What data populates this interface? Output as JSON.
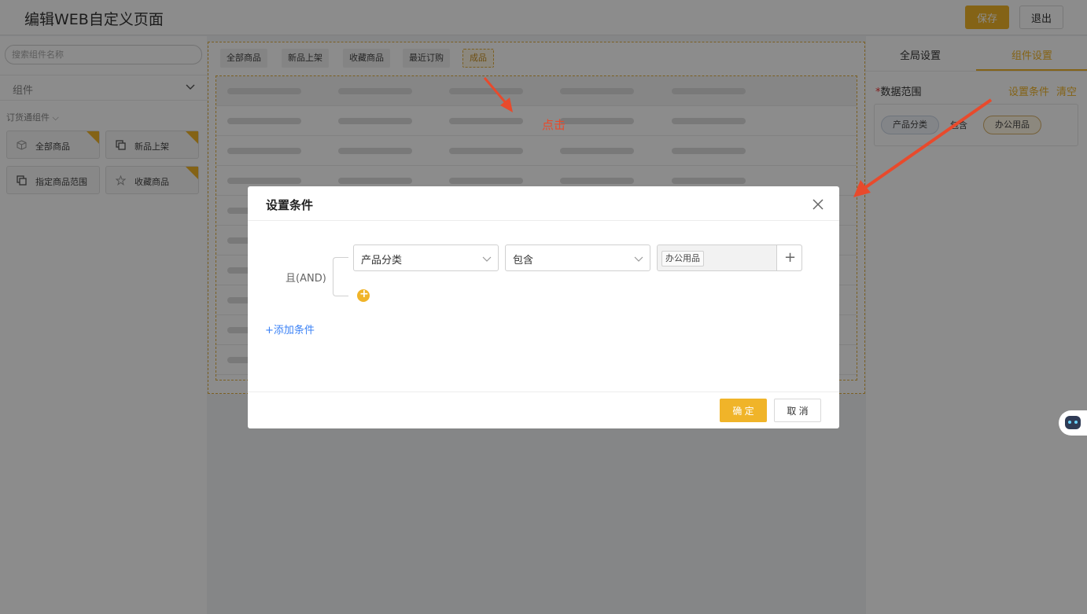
{
  "header": {
    "title": "编辑WEB自定义页面",
    "save_label": "保存",
    "exit_label": "退出"
  },
  "left_panel": {
    "search_placeholder": "搜索组件名称",
    "group_label": "组件",
    "sub_group_label": "订货通组件",
    "components": [
      {
        "label": "全部商品",
        "icon": "cube-icon"
      },
      {
        "label": "新品上架",
        "icon": "copy-icon"
      },
      {
        "label": "指定商品范围",
        "icon": "copy-icon"
      },
      {
        "label": "收藏商品",
        "icon": "star-icon"
      }
    ]
  },
  "canvas": {
    "tabs": [
      "全部商品",
      "新品上架",
      "收藏商品",
      "最近订购",
      "成品"
    ],
    "active_tab": "成品",
    "annotation": "点击"
  },
  "right_panel": {
    "tab_global": "全局设置",
    "tab_component": "组件设置",
    "data_range_label": "数据范围",
    "required_mark": "*",
    "set_condition_link": "设置条件",
    "clear_link": "清空",
    "condition": {
      "field": "产品分类",
      "operator": "包含",
      "value": "办公用品"
    }
  },
  "modal": {
    "title": "设置条件",
    "and_label": "且(AND)",
    "field_value": "产品分类",
    "operator_value": "包含",
    "selected_tag": "办公用品",
    "add_condition_label": "+添加条件",
    "confirm_label": "确 定",
    "cancel_label": "取 消"
  },
  "colors": {
    "accent": "#f0b429",
    "link": "#3b82f6",
    "annotation": "#e84a2c"
  }
}
